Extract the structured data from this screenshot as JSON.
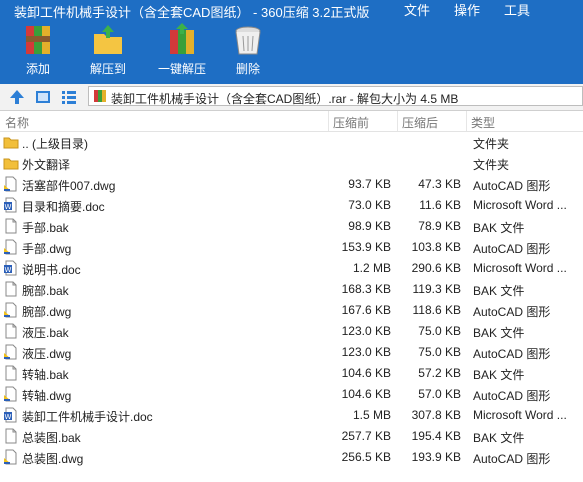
{
  "window": {
    "title": "装卸工件机械手设计（含全套CAD图纸） - 360压缩 3.2正式版",
    "menu": [
      "文件",
      "操作",
      "工具"
    ]
  },
  "toolbar": {
    "add": "添加",
    "extract_to": "解压到",
    "one_click_extract": "一键解压",
    "delete": "删除"
  },
  "address": {
    "path": "装卸工件机械手设计（含全套CAD图纸）.rar - 解包大小为 4.5 MB"
  },
  "columns": {
    "name": "名称",
    "size": "压缩前",
    "packed": "压缩后",
    "type": "类型"
  },
  "files": [
    {
      "name": ".. (上级目录)",
      "size": "",
      "packed": "",
      "type": "文件夹",
      "icon": "folder-icon"
    },
    {
      "name": "外文翻译",
      "size": "",
      "packed": "",
      "type": "文件夹",
      "icon": "folder-icon"
    },
    {
      "name": "活塞部件007.dwg",
      "size": "93.7 KB",
      "packed": "47.3 KB",
      "type": "AutoCAD 图形",
      "icon": "dwg-file-icon"
    },
    {
      "name": "目录和摘要.doc",
      "size": "73.0 KB",
      "packed": "11.6 KB",
      "type": "Microsoft Word ...",
      "icon": "word-file-icon"
    },
    {
      "name": "手部.bak",
      "size": "98.9 KB",
      "packed": "78.9 KB",
      "type": "BAK 文件",
      "icon": "blank-file-icon"
    },
    {
      "name": "手部.dwg",
      "size": "153.9 KB",
      "packed": "103.8 KB",
      "type": "AutoCAD 图形",
      "icon": "dwg-file-icon"
    },
    {
      "name": "说明书.doc",
      "size": "1.2 MB",
      "packed": "290.6 KB",
      "type": "Microsoft Word ...",
      "icon": "word-file-icon"
    },
    {
      "name": "腕部.bak",
      "size": "168.3 KB",
      "packed": "119.3 KB",
      "type": "BAK 文件",
      "icon": "blank-file-icon"
    },
    {
      "name": "腕部.dwg",
      "size": "167.6 KB",
      "packed": "118.6 KB",
      "type": "AutoCAD 图形",
      "icon": "dwg-file-icon"
    },
    {
      "name": "液压.bak",
      "size": "123.0 KB",
      "packed": "75.0 KB",
      "type": "BAK 文件",
      "icon": "blank-file-icon"
    },
    {
      "name": "液压.dwg",
      "size": "123.0 KB",
      "packed": "75.0 KB",
      "type": "AutoCAD 图形",
      "icon": "dwg-file-icon"
    },
    {
      "name": "转轴.bak",
      "size": "104.6 KB",
      "packed": "57.2 KB",
      "type": "BAK 文件",
      "icon": "blank-file-icon"
    },
    {
      "name": "转轴.dwg",
      "size": "104.6 KB",
      "packed": "57.0 KB",
      "type": "AutoCAD 图形",
      "icon": "dwg-file-icon"
    },
    {
      "name": "装卸工件机械手设计.doc",
      "size": "1.5 MB",
      "packed": "307.8 KB",
      "type": "Microsoft Word ...",
      "icon": "word-file-icon"
    },
    {
      "name": "总装图.bak",
      "size": "257.7 KB",
      "packed": "195.4 KB",
      "type": "BAK 文件",
      "icon": "blank-file-icon"
    },
    {
      "name": "总装图.dwg",
      "size": "256.5 KB",
      "packed": "193.9 KB",
      "type": "AutoCAD 图形",
      "icon": "dwg-file-icon"
    }
  ]
}
